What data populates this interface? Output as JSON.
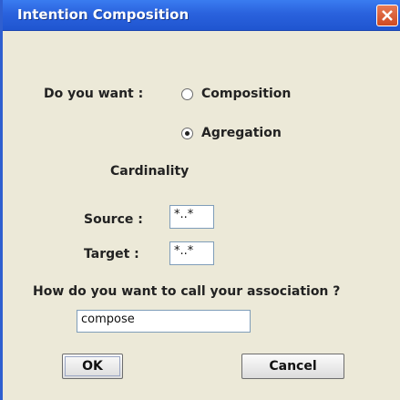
{
  "window": {
    "title": "Intention Composition"
  },
  "question": {
    "label": "Do you want :"
  },
  "options": [
    {
      "label": "Composition",
      "selected": false
    },
    {
      "label": "Agregation",
      "selected": true
    }
  ],
  "cardinality": {
    "heading": "Cardinality",
    "source_label": "Source :",
    "source_value": "*..*",
    "target_label": "Target :",
    "target_value": "*..*"
  },
  "association": {
    "prompt": "How do you want to call your association ?",
    "value": "compose"
  },
  "buttons": {
    "ok": "OK",
    "cancel": "Cancel"
  }
}
